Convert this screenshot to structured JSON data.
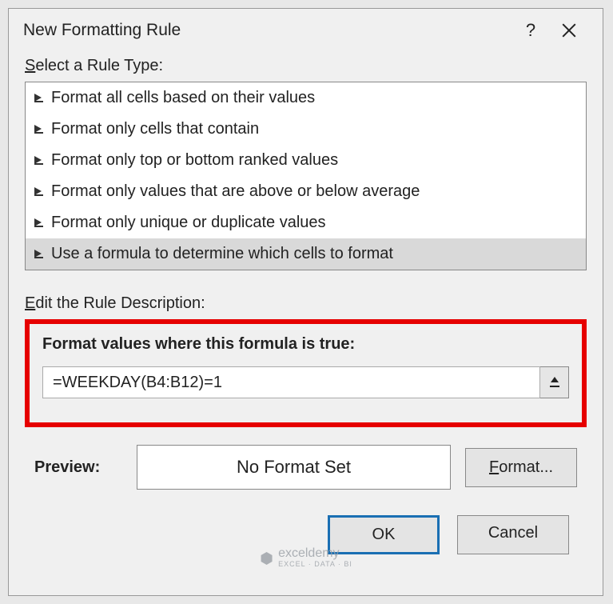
{
  "titlebar": {
    "title": "New Formatting Rule",
    "help": "?"
  },
  "select_label_u": "S",
  "select_label_rest": "elect a Rule Type:",
  "rule_types": [
    "Format all cells based on their values",
    "Format only cells that contain",
    "Format only top or bottom ranked values",
    "Format only values that are above or below average",
    "Format only unique or duplicate values",
    "Use a formula to determine which cells to format"
  ],
  "edit_label_u": "E",
  "edit_label_rest": "dit the Rule Description:",
  "formula_caption": "Format values where this formula is true:",
  "formula_value": "=WEEKDAY(B4:B12)=1",
  "preview_label": "Preview:",
  "preview_text": "No Format Set",
  "format_btn_u": "F",
  "format_btn_rest": "ormat...",
  "ok_label": "OK",
  "cancel_label": "Cancel",
  "watermark": {
    "brand": "exceldemy",
    "sub": "EXCEL · DATA · BI"
  }
}
